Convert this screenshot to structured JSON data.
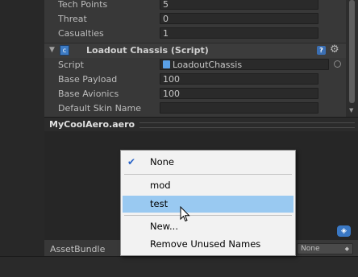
{
  "inspector": {
    "rows_top": [
      {
        "label": "Tech Points",
        "value": "5"
      },
      {
        "label": "Threat",
        "value": "0"
      },
      {
        "label": "Casualties",
        "value": "1"
      }
    ],
    "component": {
      "title": "Loadout Chassis (Script)",
      "help_icon": "help-icon",
      "gear_icon": "gear-icon"
    },
    "rows_comp": [
      {
        "label": "Script",
        "value": "LoadoutChassis"
      },
      {
        "label": "Base Payload",
        "value": "100"
      },
      {
        "label": "Base Avionics",
        "value": "100"
      },
      {
        "label": "Default Skin Name",
        "value": ""
      }
    ]
  },
  "preview": {
    "title": "MyCoolAero.aero"
  },
  "asset_bundle": {
    "label": "AssetBundle",
    "value": "None"
  },
  "menu": {
    "items": [
      {
        "label": "None",
        "checked": true
      },
      {
        "label": "mod"
      },
      {
        "label": "test",
        "highlighted": true
      },
      {
        "label": "New..."
      },
      {
        "label": "Remove Unused Names"
      }
    ]
  },
  "colors": {
    "highlight": "#99c9f1",
    "check": "#2a64c8",
    "accent": "#3a78c4"
  }
}
